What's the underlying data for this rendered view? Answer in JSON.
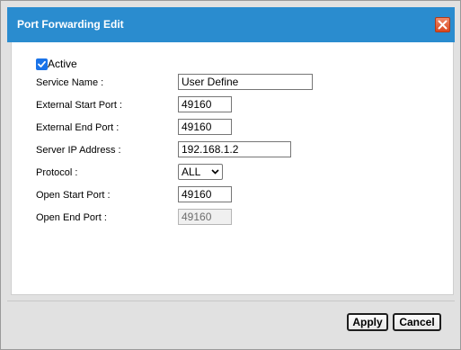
{
  "dialog": {
    "title": "Port Forwarding Edit"
  },
  "form": {
    "active_label": "Active",
    "active_checked": true,
    "service_name_label": "Service Name :",
    "service_name_value": "User Define",
    "external_start_port_label": "External Start Port :",
    "external_start_port_value": "49160",
    "external_end_port_label": "External End Port :",
    "external_end_port_value": "49160",
    "server_ip_label": "Server IP Address :",
    "server_ip_value": "192.168.1.2",
    "protocol_label": "Protocol :",
    "protocol_value": "ALL",
    "open_start_port_label": "Open Start Port :",
    "open_start_port_value": "49160",
    "open_end_port_label": "Open End Port :",
    "open_end_port_value": "49160"
  },
  "footer": {
    "apply_label": "Apply",
    "cancel_label": "Cancel"
  },
  "colors": {
    "titlebar": "#2a8ccf",
    "close_button": "#d9471f",
    "checkbox": "#1a73e8"
  },
  "icons": {
    "close": "close-icon",
    "check": "check-icon",
    "dropdown": "chevron-down-icon"
  }
}
